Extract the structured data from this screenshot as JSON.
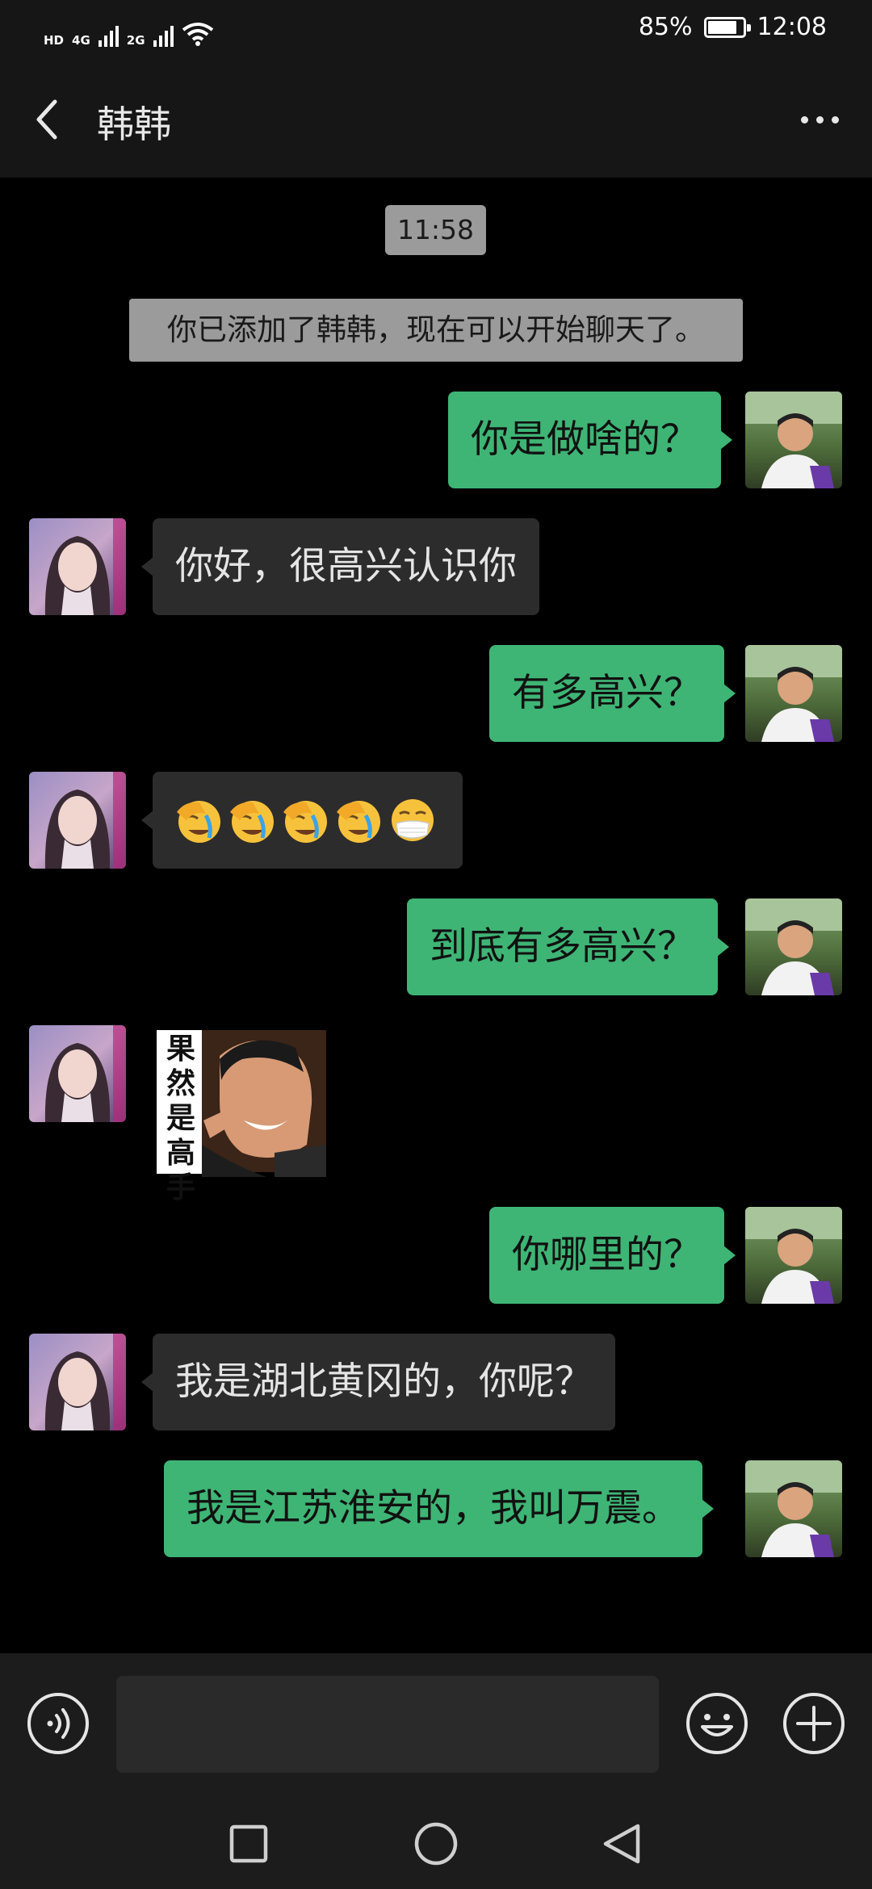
{
  "status_bar": {
    "hd_label": "HD",
    "sim1_network": "4G",
    "sim2_network": "2G",
    "battery_percent": "85%",
    "battery_level": 0.85,
    "time": "12:08",
    "icons": [
      "hd-volte-icon",
      "signal-icon",
      "wifi-icon",
      "battery-icon"
    ]
  },
  "nav": {
    "title": "韩韩",
    "back_icon": "chevron-left-icon",
    "more_icon": "more-dots-icon"
  },
  "chat": {
    "timestamp": "11:58",
    "system_notice": "你已添加了韩韩，现在可以开始聊天了。",
    "messages": [
      {
        "from": "me",
        "text": "你是做啥的？"
      },
      {
        "from": "other",
        "text": "你好，很高兴认识你"
      },
      {
        "from": "me",
        "text": "有多高兴？"
      },
      {
        "from": "other",
        "emojis": [
          "facepalm-crying",
          "facepalm-crying",
          "facepalm-crying",
          "facepalm-crying",
          "mask-face"
        ]
      },
      {
        "from": "me",
        "text": "到底有多高兴？"
      },
      {
        "from": "other",
        "sticker": "sticker-image",
        "sticker_text": "果然是高手"
      },
      {
        "from": "me",
        "text": "你哪里的？"
      },
      {
        "from": "other",
        "text": "我是湖北黄冈的，你呢？"
      },
      {
        "from": "me",
        "text": "我是江苏淮安的，我叫万震。"
      }
    ]
  },
  "input_bar": {
    "voice_icon": "voice-icon",
    "text_value": "",
    "emoji_icon": "emoji-icon",
    "plus_icon": "plus-icon"
  },
  "system_nav": {
    "icons": [
      "recent-apps-icon",
      "home-icon",
      "back-triangle-icon"
    ]
  },
  "colors": {
    "background": "#000000",
    "bar": "#161616",
    "bubble_me": "#3eb575",
    "bubble_other": "#2c2c2c",
    "notice": "#9b9b9b"
  }
}
